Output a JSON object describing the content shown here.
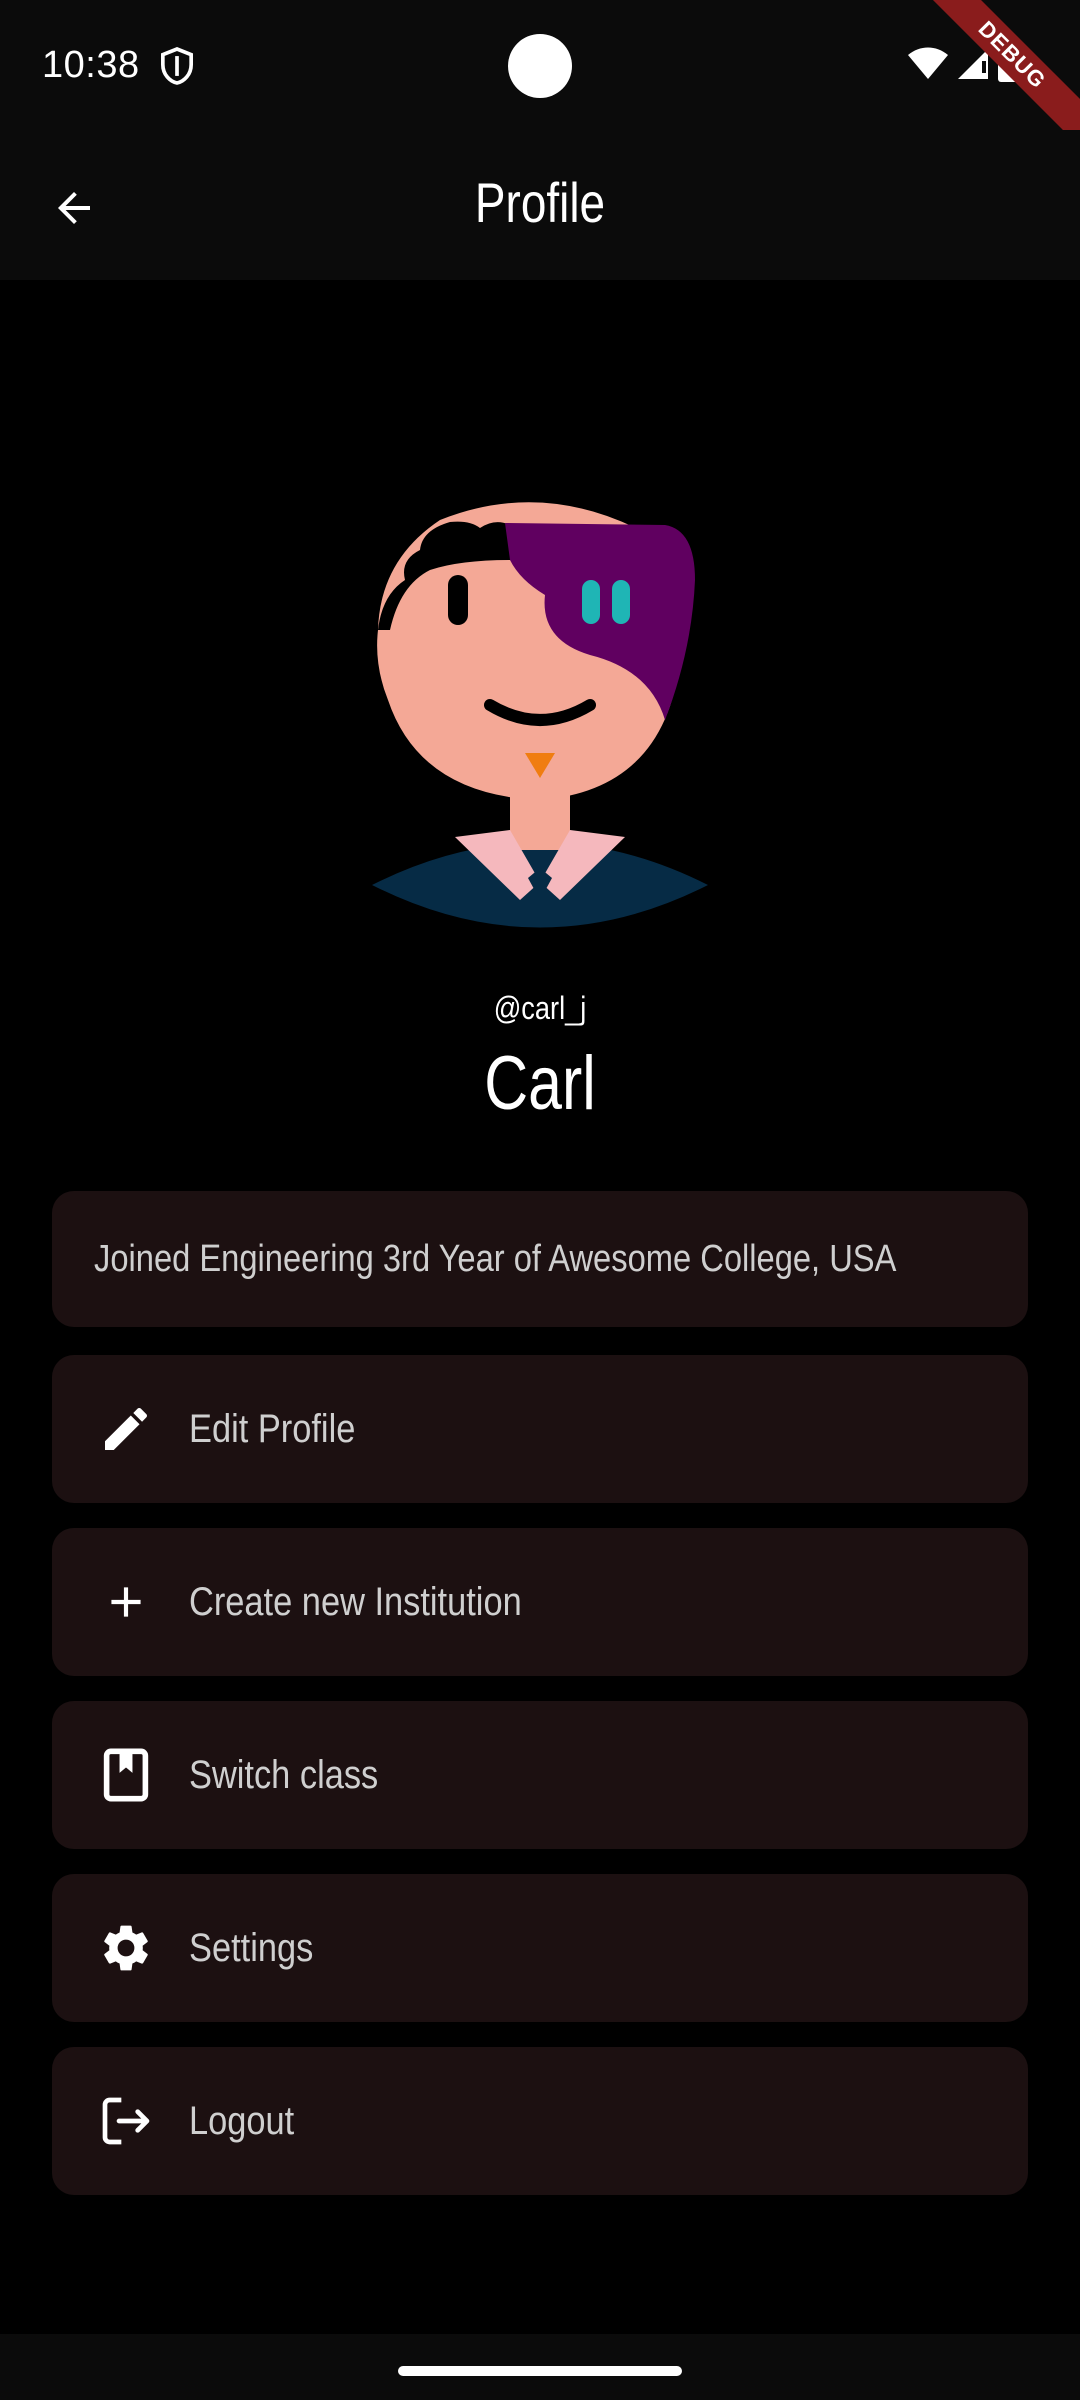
{
  "status_bar": {
    "time": "10:38",
    "icons": [
      "shield-icon",
      "wifi-icon",
      "signal-icon",
      "battery-icon"
    ],
    "debug_label": "DEBUG"
  },
  "header": {
    "title": "Profile",
    "back_icon": "arrow-left-icon"
  },
  "profile": {
    "username": "@carl_j",
    "name": "Carl",
    "info": "Joined Engineering 3rd Year of Awesome College, USA"
  },
  "menu": {
    "items": [
      {
        "label": "Edit Profile",
        "icon": "pencil-icon"
      },
      {
        "label": "Create new Institution",
        "icon": "plus-icon"
      },
      {
        "label": "Switch class",
        "icon": "book-icon"
      },
      {
        "label": "Settings",
        "icon": "gear-icon"
      },
      {
        "label": "Logout",
        "icon": "logout-icon"
      }
    ]
  },
  "colors": {
    "background": "#000000",
    "card": "#1c1011",
    "avatar_skin": "#f4a896",
    "avatar_hair_accent": "#600060",
    "avatar_eyes_accent": "#1fb5b5",
    "avatar_shirt": "#062b45",
    "avatar_collar": "#f5b8bd",
    "debug_ribbon": "#8a1c1c"
  }
}
